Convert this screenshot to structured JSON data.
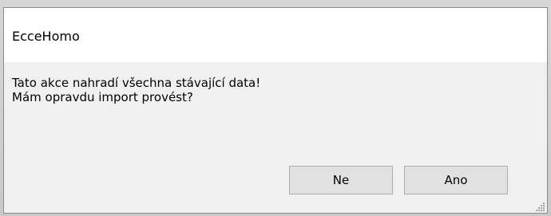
{
  "window": {
    "title": "EcceHomo"
  },
  "message": {
    "line1": "Tato akce nahradí všechna stávající data!",
    "line2": "Mám opravdu import provést?"
  },
  "buttons": {
    "no_label": "Ne",
    "yes_label": "Ano"
  },
  "colors": {
    "dialog_background": "#f0f0f0",
    "titlebar_background": "#ffffff",
    "button_background": "#e1e1e1",
    "button_border": "#adadad"
  },
  "icons": {
    "resize_grip": "size-grip-icon"
  }
}
